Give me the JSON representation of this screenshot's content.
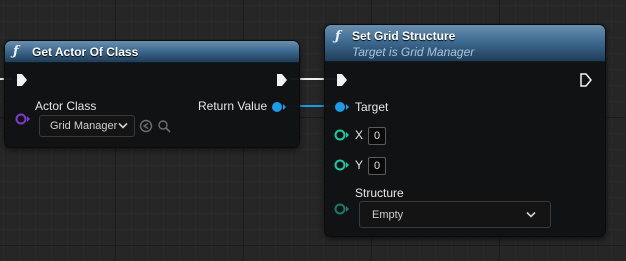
{
  "colors": {
    "background": "#262626",
    "exec": "#f2f2f2",
    "object_pin": "#1e9be6",
    "class_pin": "#7e3cc8",
    "int_pin": "#1ec8a0",
    "struct_pin": "#1c7a6c",
    "header_top": "#6a8fae",
    "header_bottom": "#1f3d58"
  },
  "nodes": {
    "get_actor": {
      "icon": "function-icon",
      "fn_glyph": "ƒ",
      "title": "Get Actor Of Class",
      "actor_class_label": "Actor Class",
      "actor_class_value": "Grid Manager",
      "return_label": "Return Value"
    },
    "set_grid": {
      "icon": "function-icon",
      "fn_glyph": "ƒ",
      "title": "Set Grid Structure",
      "subtitle": "Target is Grid Manager",
      "target_label": "Target",
      "x_label": "X",
      "x_value": "0",
      "y_label": "Y",
      "y_value": "0",
      "structure_label": "Structure",
      "structure_value": "Empty"
    }
  }
}
